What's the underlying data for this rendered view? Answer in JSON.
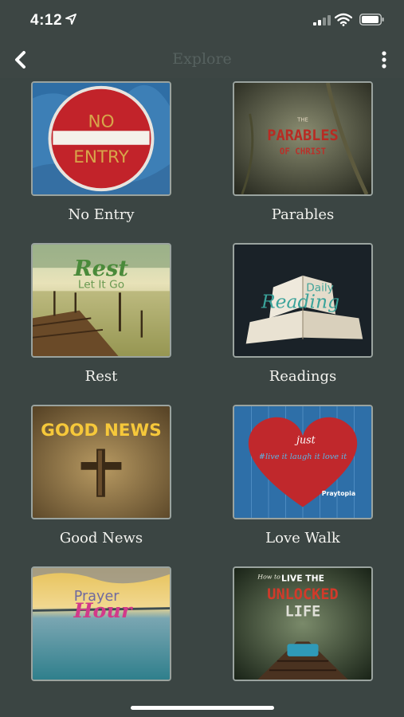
{
  "status_bar": {
    "time": "4:12"
  },
  "nav": {
    "title": "Explore"
  },
  "tiles": [
    {
      "label": "No Entry",
      "image_text": [
        "NO",
        "ENTRY"
      ]
    },
    {
      "label": "Parables",
      "image_text": [
        "THE",
        "PARABLES",
        "OF CHRIST"
      ]
    },
    {
      "label": "Rest",
      "image_text": [
        "Rest",
        "Let It Go"
      ]
    },
    {
      "label": "Readings",
      "image_text": [
        "Daily",
        "Reading"
      ]
    },
    {
      "label": "Good News",
      "image_text": [
        "GOOD NEWS"
      ]
    },
    {
      "label": "Love Walk",
      "image_text": [
        "just",
        "#live it laugh it love it",
        "Praytopia"
      ]
    },
    {
      "label": "",
      "image_text": [
        "Prayer",
        "Hour"
      ]
    },
    {
      "label": "",
      "image_text": [
        "How to",
        "LIVE THE",
        "UNLOCKED",
        "LIFE"
      ]
    }
  ]
}
